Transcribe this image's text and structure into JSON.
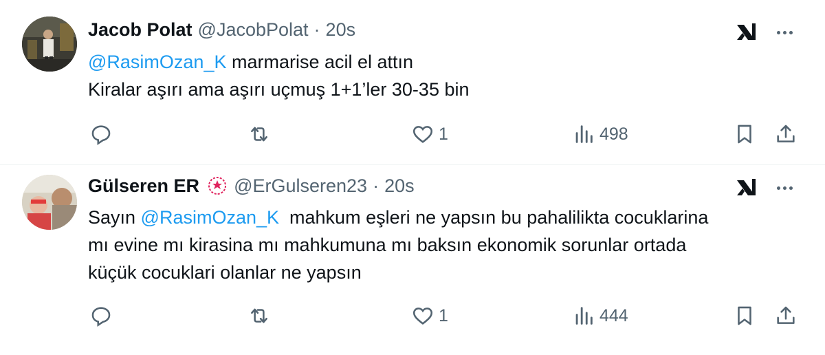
{
  "tweets": [
    {
      "author": {
        "name": "Jacob Polat",
        "handle": "@JacobPolat"
      },
      "time": "20s",
      "separator": "·",
      "mention": "@RasimOzan_K",
      "line1_rest": " marmarise acil el attın",
      "line2": "Kiralar aşırı ama aşırı uçmuş 1+1’ler 30-35 bin",
      "stats": {
        "likes": "1",
        "views": "498"
      }
    },
    {
      "author": {
        "name": "Gülseren ER",
        "handle": "@ErGulseren23"
      },
      "time": "20s",
      "separator": "·",
      "prefix": "Sayın ",
      "mention": "@RasimOzan_K",
      "line1_rest": "  mahkum eşleri ne yapsın bu pahalilikta cocuklarina",
      "line2": "mı evine mı kirasina mı mahkumuna mı baksın ekonomik sorunlar ortada",
      "line3": "küçük cocuklari olanlar ne yapsın",
      "stats": {
        "likes": "1",
        "views": "444"
      }
    }
  ],
  "icons": {
    "grok": "grok-icon",
    "more": "more-icon",
    "reply": "reply-icon",
    "retweet": "retweet-icon",
    "like": "like-icon",
    "views": "views-icon",
    "bookmark": "bookmark-icon",
    "share": "share-icon",
    "badge": "verified-badge-icon"
  },
  "colors": {
    "text": "#0f1419",
    "secondary": "#536471",
    "link": "#1d9bf0",
    "badge": "#e0245e",
    "divider": "#eff3f4"
  }
}
